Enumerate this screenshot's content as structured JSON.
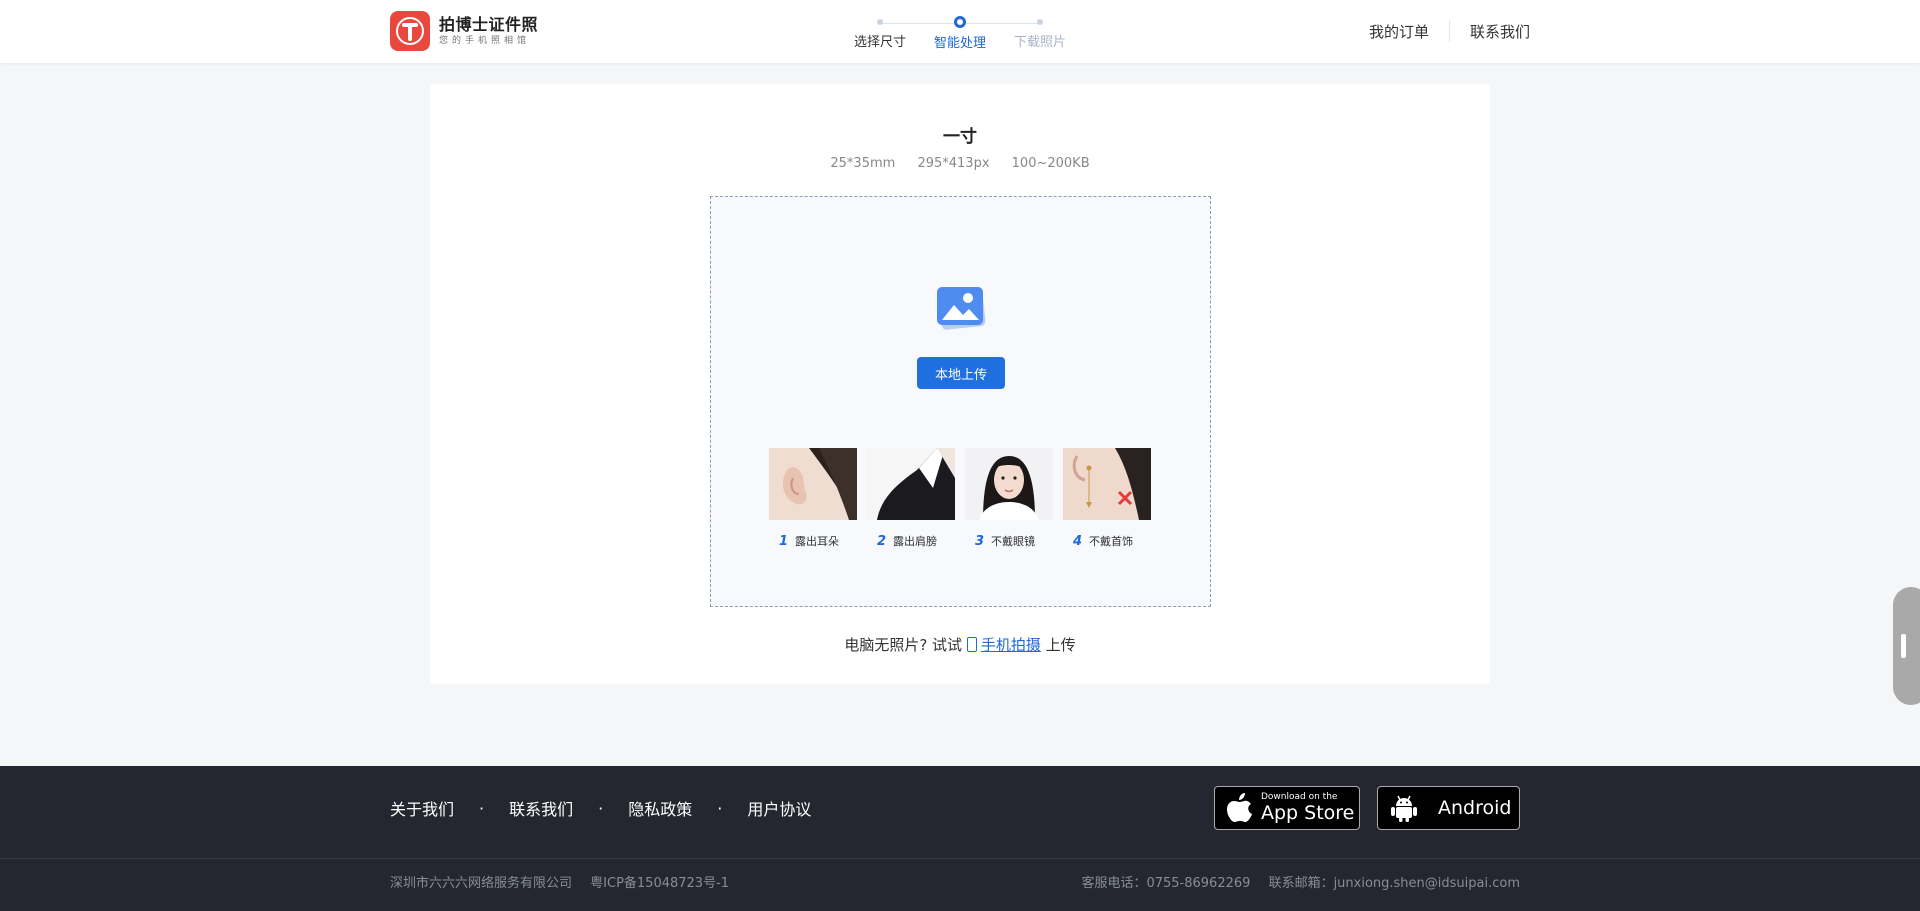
{
  "header": {
    "logo_title": "拍博士证件照",
    "logo_subtitle": "您的手机照相馆",
    "steps": [
      {
        "label": "选择尺寸",
        "state": "done"
      },
      {
        "label": "智能处理",
        "state": "active"
      },
      {
        "label": "下载照片",
        "state": "future"
      }
    ],
    "nav": {
      "orders": "我的订单",
      "contact": "联系我们"
    }
  },
  "main": {
    "size_name": "一寸",
    "specs": [
      "25*35mm",
      "295*413px",
      "100~200KB"
    ],
    "upload_button": "本地上传",
    "tips": [
      {
        "num": "1",
        "text": "露出耳朵"
      },
      {
        "num": "2",
        "text": "露出肩膀"
      },
      {
        "num": "3",
        "text": "不戴眼镜"
      },
      {
        "num": "4",
        "text": "不戴首饰"
      }
    ],
    "phone_prompt_prefix": "电脑无照片? 试试",
    "phone_link": "手机拍摄",
    "phone_prompt_suffix": "上传"
  },
  "footer": {
    "links": [
      "关于我们",
      "联系我们",
      "隐私政策",
      "用户协议"
    ],
    "ios_small": "Download on the",
    "ios_big": "App Store",
    "android": "Android",
    "company": "深圳市六六六网络服务有限公司",
    "icp": "粤ICP备15048723号-1",
    "phone": "客服电话：0755-86962269",
    "email": "联系邮箱：junxiong.shen@idsuipai.com"
  },
  "colors": {
    "accent": "#2168d8",
    "logo": "#e9483f",
    "footer_bg": "#242730"
  }
}
